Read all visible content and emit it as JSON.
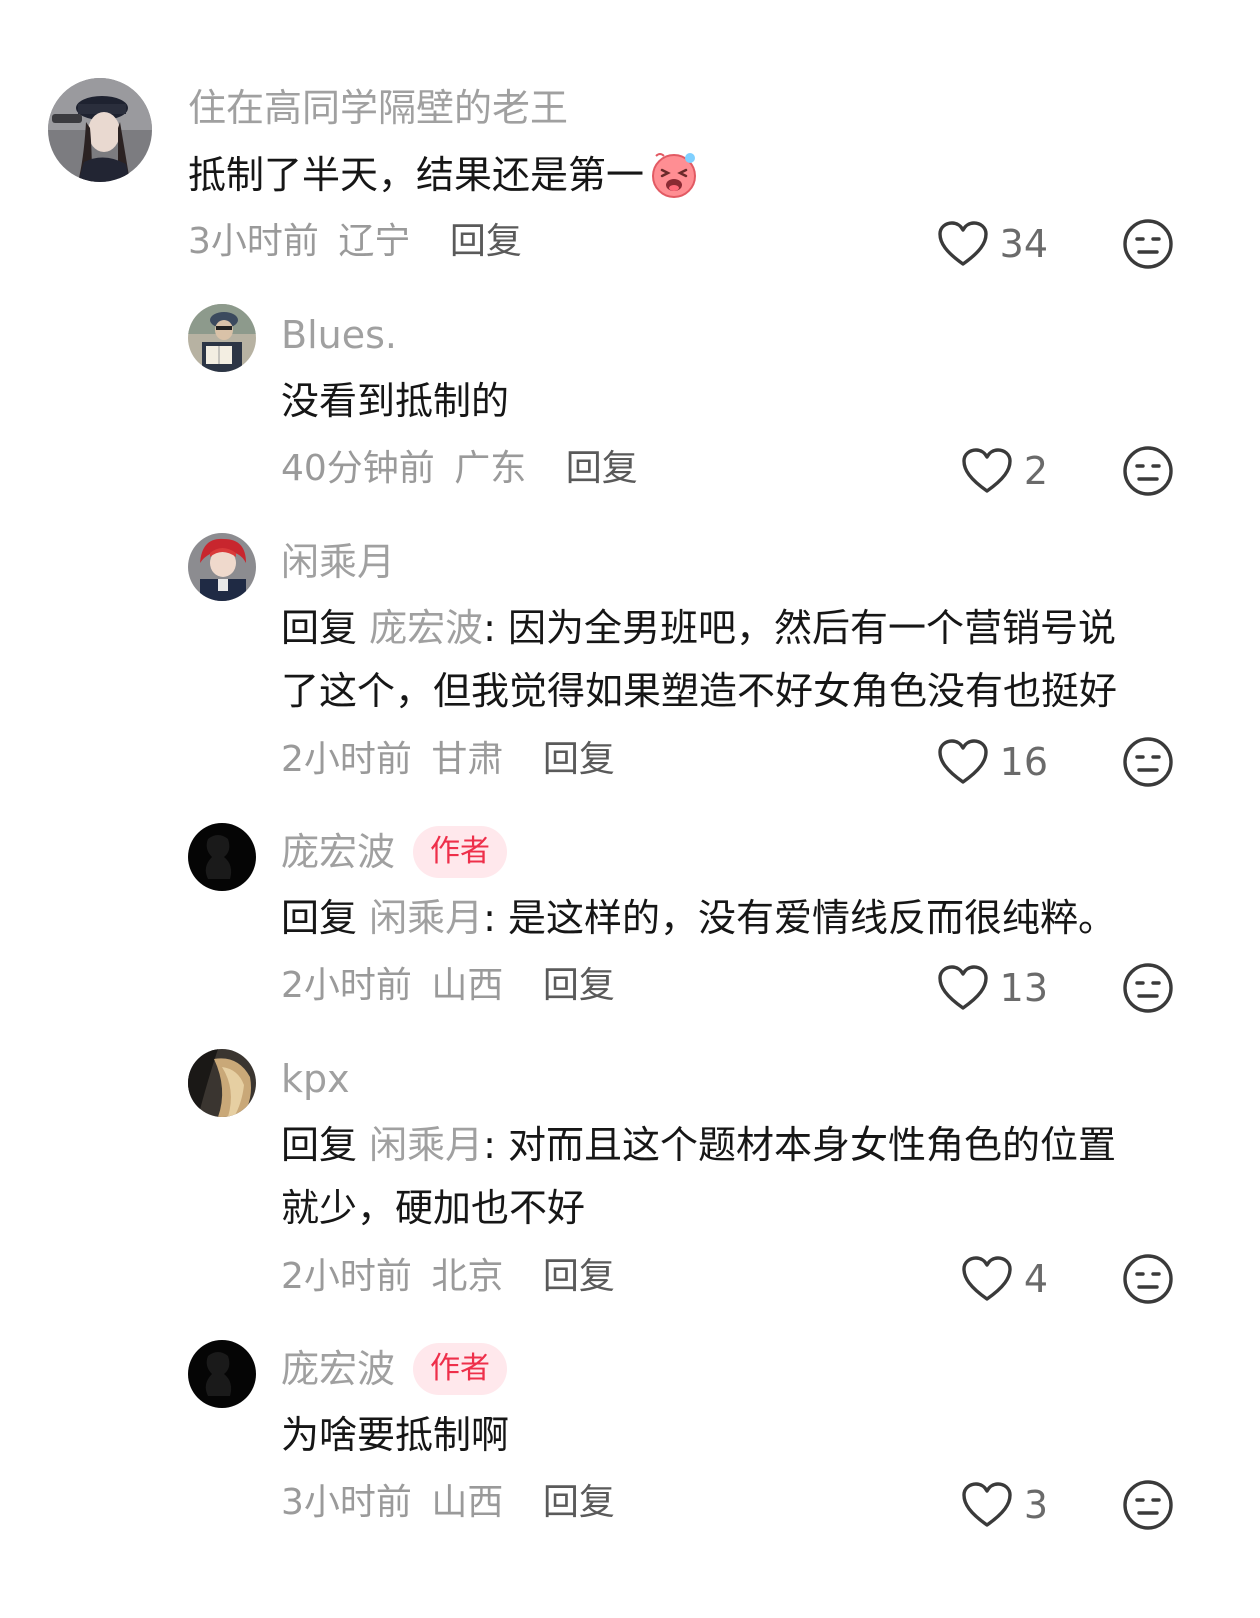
{
  "comments": [
    {
      "name": "住在高同学隔壁的老王",
      "text": "抵制了半天，结果还是第一",
      "time": "3小时前",
      "location": "辽宁",
      "reply_label": "回复",
      "likes": "34"
    },
    {
      "name": "Blues.",
      "text": "没看到抵制的",
      "time": "40分钟前",
      "location": "广东",
      "reply_label": "回复",
      "likes": "2"
    },
    {
      "name": "闲乘月",
      "reply_prefix": "回复",
      "reply_to": "庞宏波",
      "text_line1": "因为全男班吧，然后有一个营销号说",
      "text_line2": "了这个，但我觉得如果塑造不好女角色没有也挺好",
      "time": "2小时前",
      "location": "甘肃",
      "reply_label": "回复",
      "likes": "16"
    },
    {
      "name": "庞宏波",
      "badge": "作者",
      "reply_prefix": "回复",
      "reply_to": "闲乘月",
      "text": "是这样的，没有爱情线反而很纯粹。",
      "time": "2小时前",
      "location": "山西",
      "reply_label": "回复",
      "likes": "13"
    },
    {
      "name": "kpx",
      "reply_prefix": "回复",
      "reply_to": "闲乘月",
      "text_line1": "对而且这个题材本身女性角色的位置",
      "text_line2": "就少，硬加也不好",
      "time": "2小时前",
      "location": "北京",
      "reply_label": "回复",
      "likes": "4"
    },
    {
      "name": "庞宏波",
      "badge": "作者",
      "text": "为啥要抵制啊",
      "time": "3小时前",
      "location": "山西",
      "reply_label": "回复",
      "likes": "3"
    }
  ],
  "colors": {
    "name_gray": "#a0a0a0",
    "badge_bg": "#ffe8ec",
    "badge_text": "#ee2f4a",
    "text": "#161616"
  },
  "icons": {
    "like": "heart-outline-icon",
    "dislike": "meh-face-icon",
    "inline_emoji": "laughing-emoji"
  }
}
